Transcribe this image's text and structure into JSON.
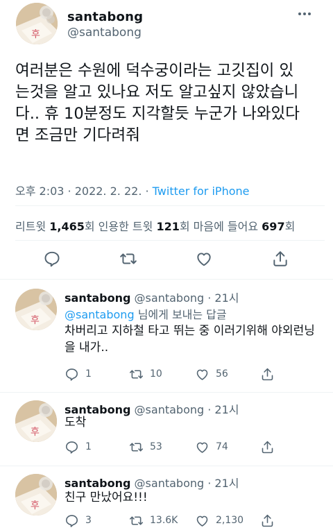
{
  "main": {
    "display_name": "santabong",
    "handle": "@santabong",
    "text": "여러분은 수원에 덕수궁이라는 고깃집이 있\n는것을 알고 있나요 저도 알고싶지 않았습니\n다.. 휴 10분정도 지각할듯 누군가 나와있다\n면 조금만 기다려줘",
    "time": "오후 2:03 · 2022. 2. 22. · ",
    "source": "Twitter for iPhone",
    "stats": {
      "retweets_label": "리트윗 ",
      "retweets": "1,465",
      "retweets_unit": "회  ",
      "quotes_label": "인용한 트윗 ",
      "quotes": "121",
      "quotes_unit": "회  ",
      "likes_label": "마음에 들어요 ",
      "likes": "697",
      "likes_unit": "회"
    }
  },
  "replies": [
    {
      "display_name": "santabong",
      "handle": "@santabong · 21시",
      "replying_mention": "@santabong",
      "replying_suffix": " 님에게 보내는 답글",
      "text": "차버리고 지하철 타고 뛰는 중 이러기위해 야외런닝\n을 내가..",
      "replies": "1",
      "retweets": "10",
      "likes": "56"
    },
    {
      "display_name": "santabong",
      "handle": "@santabong · 21시",
      "text": "도착",
      "replies": "1",
      "retweets": "53",
      "likes": "74"
    },
    {
      "display_name": "santabong",
      "handle": "@santabong · 21시",
      "text": "친구 만났어요!!!",
      "replies": "3",
      "retweets": "13.6K",
      "likes": "2,130"
    }
  ],
  "colors": {
    "accent": "#1d9bf0",
    "text": "#0f1419",
    "secondary": "#536471",
    "divider": "#eff3f4"
  },
  "icons": [
    "more-icon",
    "reply-icon",
    "retweet-icon",
    "like-icon",
    "share-icon"
  ]
}
